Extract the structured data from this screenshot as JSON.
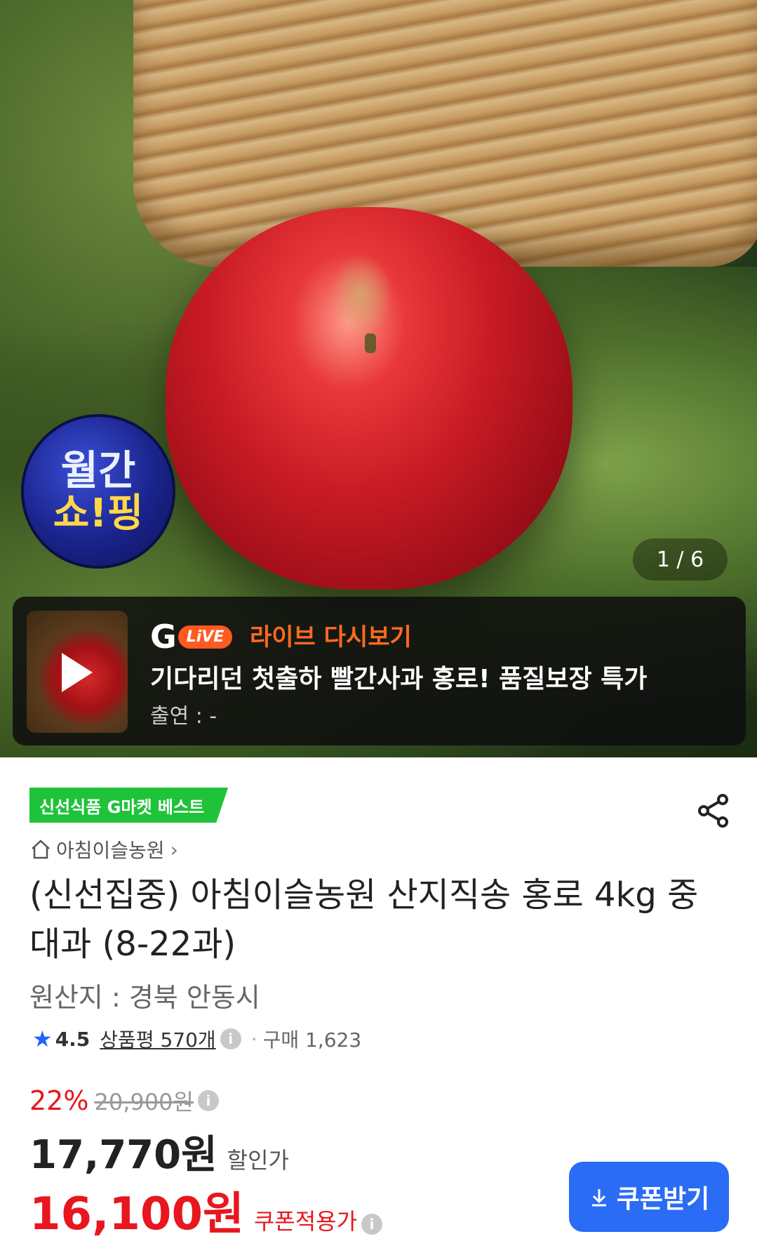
{
  "hero": {
    "badge_line1": "월간",
    "badge_line2": "쇼!핑",
    "pager": "1 / 6"
  },
  "live": {
    "logo_g": "G",
    "logo_pill": "LiVE",
    "label": "라이브 다시보기",
    "title": "기다리던 첫출하 빨간사과 홍로! 품질보장 특가",
    "cast": "출연 : -"
  },
  "product": {
    "tag": "신선식품 G마켓 베스트",
    "store": "아침이슬농원",
    "store_chevron": "›",
    "title": "(신선집중) 아침이슬농원 산지직송 홍로 4kg 중대과 (8-22과)",
    "origin": "원산지 : 경북 안동시",
    "rating": "4.5",
    "review": "상품평 570개",
    "purchase": "구매 1,623",
    "discount": "22%",
    "original_price": "20,900원",
    "sale_price": "17,770원",
    "sale_label": "할인가",
    "coupon_price": "16,100원",
    "coupon_label": "쿠폰적용가",
    "coupon_button": "쿠폰받기"
  },
  "colors": {
    "accent_blue": "#2a6cf5",
    "price_red": "#e8161e",
    "tag_green": "#1fc33a",
    "live_orange": "#ff6a1f"
  }
}
